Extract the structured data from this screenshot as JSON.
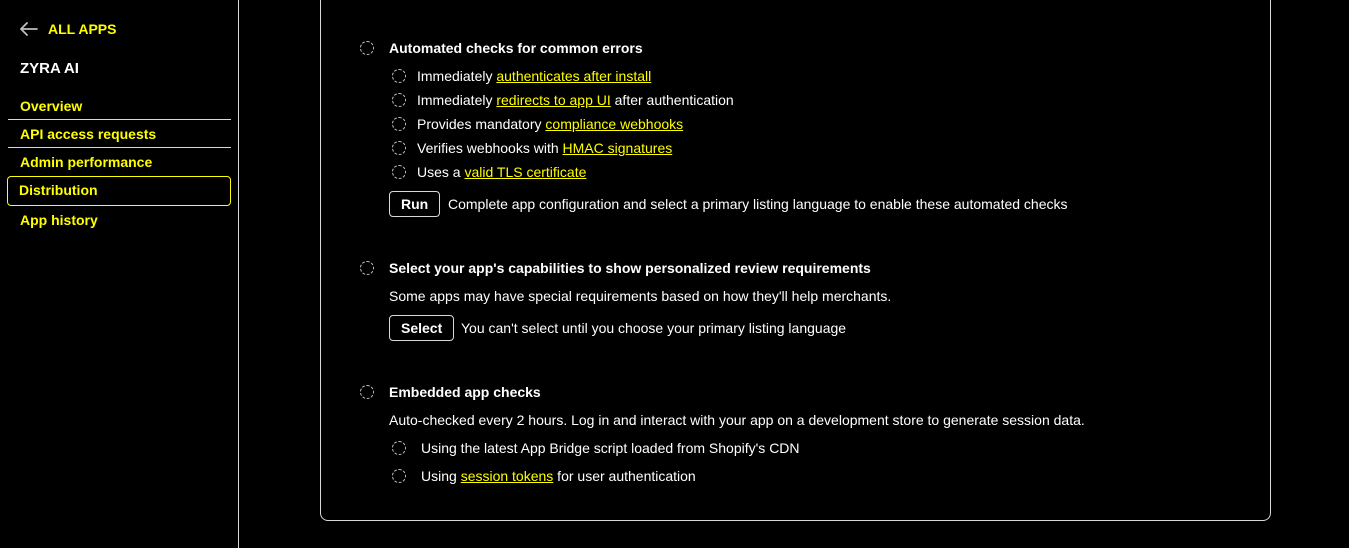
{
  "sidebar": {
    "back_label": "ALL APPS",
    "app_name": "ZYRA AI",
    "items": [
      {
        "label": "Overview"
      },
      {
        "label": "API access requests"
      },
      {
        "label": "Admin performance"
      },
      {
        "label": "Distribution"
      },
      {
        "label": "App history"
      }
    ]
  },
  "automated": {
    "title": "Automated checks for common errors",
    "checks": [
      {
        "prefix": "Immediately ",
        "link": "authenticates after install",
        "suffix": ""
      },
      {
        "prefix": "Immediately ",
        "link": "redirects to app UI",
        "suffix": " after authentication"
      },
      {
        "prefix": "Provides mandatory ",
        "link": "compliance webhooks",
        "suffix": ""
      },
      {
        "prefix": "Verifies webhooks with ",
        "link": "HMAC signatures",
        "suffix": ""
      },
      {
        "prefix": "Uses a ",
        "link": "valid TLS certificate",
        "suffix": ""
      }
    ],
    "run_label": "Run",
    "run_note": "Complete app configuration and select a primary listing language to enable these automated checks"
  },
  "capabilities": {
    "title": "Select your app's capabilities to show personalized review requirements",
    "description": "Some apps may have special requirements based on how they'll help merchants.",
    "select_label": "Select",
    "select_note": "You can't select until you choose your primary listing language"
  },
  "embedded": {
    "title": "Embedded app checks",
    "description": "Auto-checked every 2 hours. Log in and interact with your app on a development store to generate session data.",
    "check1": "Using the latest App Bridge script loaded from Shopify's CDN",
    "check2": {
      "prefix": "Using ",
      "link": "session tokens",
      "suffix": " for user authentication"
    }
  },
  "colors": {
    "accent": "#ffff00",
    "background": "#000000",
    "border": "#d9d9d9"
  }
}
